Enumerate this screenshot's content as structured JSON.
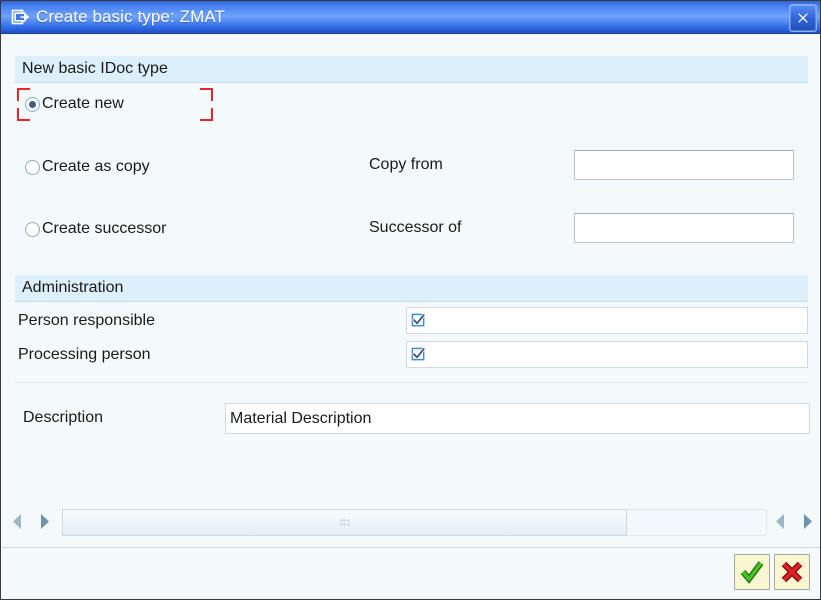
{
  "window": {
    "title": "Create basic type: ZMAT",
    "title_icon": "create-document-icon",
    "close_icon": "close-icon"
  },
  "sections": [
    {
      "key": "new_basic_idoc_type",
      "title": "New basic IDoc type",
      "radios": [
        {
          "label": "Create new",
          "checked": true,
          "focused": true
        },
        {
          "label": "Create as copy",
          "checked": false,
          "focused": false
        },
        {
          "label": "Create successor",
          "checked": false,
          "focused": false
        }
      ],
      "fields": [
        {
          "label": "Copy from",
          "value": "",
          "placeholder": ""
        },
        {
          "label": "Successor of",
          "value": "",
          "placeholder": ""
        }
      ]
    },
    {
      "key": "administration",
      "title": "Administration",
      "fields": [
        {
          "label": "Person responsible",
          "value": "",
          "icon": "checkbox-checked-icon"
        },
        {
          "label": "Processing person",
          "value": "",
          "icon": "checkbox-checked-icon"
        }
      ]
    }
  ],
  "description": {
    "label": "Description",
    "value": "Material Description"
  },
  "scrollbar": {
    "left_arrow_icon": "arrow-left-icon",
    "right_arrow_icon": "arrow-right-icon",
    "far_left_arrow_icon": "arrow-left-icon",
    "far_right_arrow_icon": "arrow-right-icon",
    "grip_icon": "grip-dots-icon"
  },
  "toolbar": {
    "confirm_label": "",
    "confirm_icon": "green-check-icon",
    "cancel_label": "",
    "cancel_icon": "red-cross-icon"
  },
  "colors": {
    "titlebar_blue": "#4a83f2",
    "section_header": "#ddeffb",
    "panel_bg": "#f4fafc",
    "focus_red": "#e8262a",
    "confirm_green": "#3fae2a",
    "cancel_red": "#d9232a"
  }
}
